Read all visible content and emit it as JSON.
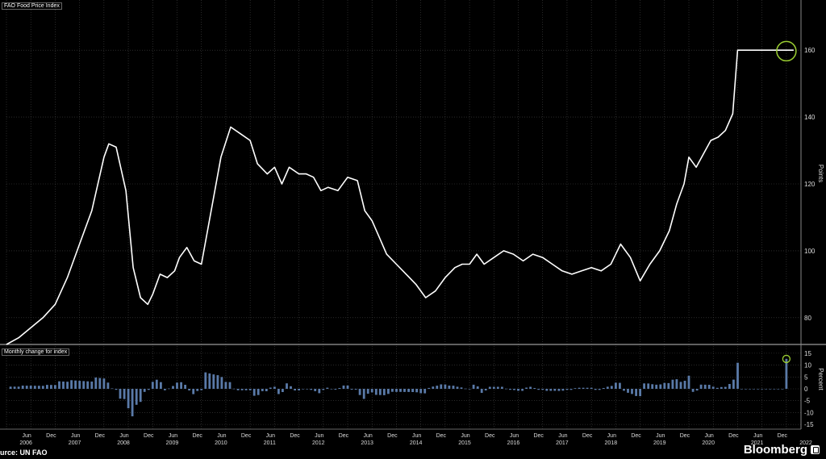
{
  "chart_data": [
    {
      "type": "line",
      "title": "FAO Food Price Index",
      "ylabel": "Points",
      "ylim": [
        72,
        175
      ],
      "yticks": [
        80,
        100,
        120,
        140,
        160
      ],
      "xlim": [
        2006.0,
        2022.3
      ],
      "grid": true,
      "x": [
        2006.0,
        2006.25,
        2006.5,
        2006.75,
        2007.0,
        2007.25,
        2007.5,
        2007.75,
        2008.0,
        2008.1,
        2008.25,
        2008.45,
        2008.6,
        2008.75,
        2008.9,
        2009.0,
        2009.15,
        2009.3,
        2009.45,
        2009.55,
        2009.7,
        2009.85,
        2010.0,
        2010.2,
        2010.4,
        2010.6,
        2010.8,
        2011.0,
        2011.15,
        2011.35,
        2011.5,
        2011.65,
        2011.8,
        2012.0,
        2012.15,
        2012.3,
        2012.45,
        2012.6,
        2012.8,
        2013.0,
        2013.2,
        2013.35,
        2013.5,
        2013.65,
        2013.8,
        2014.0,
        2014.2,
        2014.4,
        2014.6,
        2014.8,
        2015.0,
        2015.2,
        2015.35,
        2015.5,
        2015.65,
        2015.8,
        2016.0,
        2016.2,
        2016.4,
        2016.6,
        2016.8,
        2017.0,
        2017.2,
        2017.4,
        2017.6,
        2017.8,
        2018.0,
        2018.2,
        2018.4,
        2018.6,
        2018.8,
        2019.0,
        2019.2,
        2019.4,
        2019.6,
        2019.75,
        2019.9,
        2020.0,
        2020.15,
        2020.3,
        2020.45,
        2020.6,
        2020.75,
        2020.9,
        2021.0,
        2021.1,
        2021.2,
        2021.35,
        2021.45,
        2021.6,
        2021.75,
        2021.85,
        2021.95,
        2022.05,
        2022.15
      ],
      "y": [
        72,
        74,
        77,
        80,
        84,
        92,
        102,
        112,
        128,
        132,
        131,
        118,
        95,
        86,
        84,
        87,
        93,
        92,
        94,
        98,
        101,
        97,
        96,
        112,
        128,
        137,
        135,
        133,
        126,
        123,
        125,
        120,
        125,
        123,
        123,
        122,
        118,
        119,
        118,
        122,
        121,
        112,
        109,
        104,
        99,
        96,
        93,
        90,
        86,
        88,
        92,
        95,
        96,
        96,
        99,
        96,
        98,
        100,
        99,
        97,
        99,
        98,
        96,
        94,
        93,
        94,
        95,
        94,
        96,
        102,
        98,
        91,
        96,
        100,
        106,
        114,
        120,
        128,
        125,
        129,
        133,
        134,
        136,
        141,
        160,
        160,
        160,
        160,
        160,
        160,
        160,
        160,
        160,
        160,
        160
      ],
      "highlight": {
        "x": 2022.0,
        "y": 159.7
      }
    },
    {
      "type": "bar",
      "title": "Monthly change for index",
      "ylabel": "Percent",
      "ylim": [
        -17,
        17
      ],
      "yticks": [
        15,
        10,
        5,
        0,
        -5,
        -10,
        -15
      ],
      "highlight_value": 12.6
    }
  ],
  "x_axis": {
    "month_labels": [
      "Jun",
      "Dec",
      "Jun",
      "Dec",
      "Jun",
      "Dec",
      "Jun",
      "Dec",
      "Jun",
      "Dec",
      "Jun",
      "Dec",
      "Jun",
      "Dec",
      "Jun",
      "Dec",
      "Jun",
      "Dec",
      "Jun",
      "Dec",
      "Jun",
      "Dec",
      "Jun",
      "Dec",
      "Jun",
      "Dec",
      "Jun",
      "Dec",
      "Jun",
      "Dec",
      "Jun",
      "Dec"
    ],
    "year_labels": [
      "2006",
      "2007",
      "2008",
      "2009",
      "2010",
      "2011",
      "2012",
      "2013",
      "2014",
      "2015",
      "2016",
      "2017",
      "2018",
      "2019",
      "2020",
      "2021",
      "2022"
    ]
  },
  "source": "urce: UN FAO",
  "brand": "Bloomberg",
  "colors": {
    "line": "#ffffff",
    "bars": "#5a7aa8",
    "highlight": "#9acd32",
    "grid": "#444444"
  }
}
